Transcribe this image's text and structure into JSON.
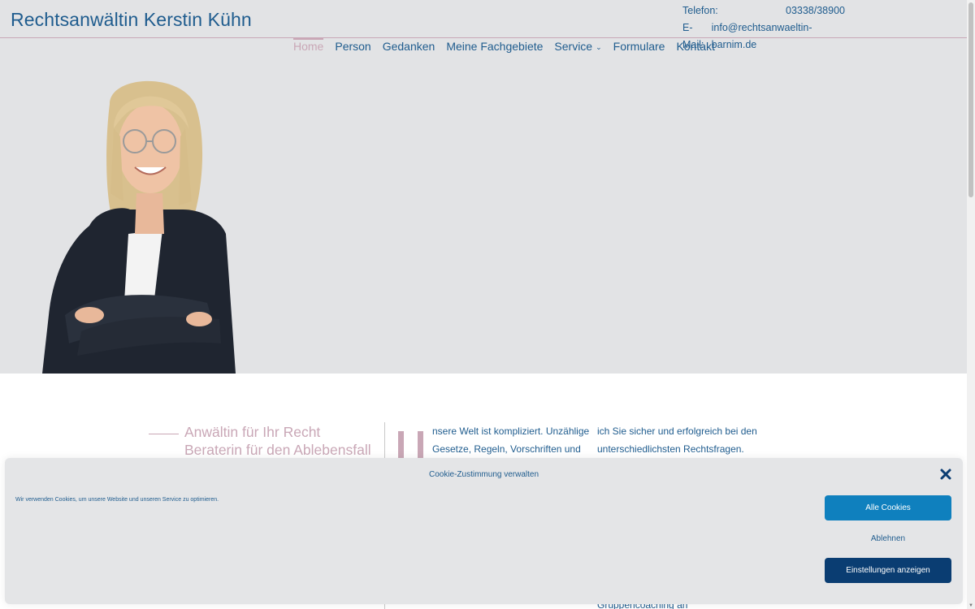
{
  "header": {
    "site_title": "Rechtsanwältin Kerstin Kühn",
    "phone_label": "Telefon:",
    "phone_value": "03338/38900",
    "email_label": "E-Mail:",
    "email_value": "info@rechtsanwaeltin-barnim.de"
  },
  "nav": {
    "items": [
      {
        "label": "Home"
      },
      {
        "label": "Person"
      },
      {
        "label": "Gedanken"
      },
      {
        "label": "Meine Fachgebiete"
      },
      {
        "label": "Service"
      },
      {
        "label": "Formulare"
      },
      {
        "label": "Kontakt"
      }
    ]
  },
  "intro": {
    "tagline_1": "Anwältin für Ihr Recht",
    "tagline_2": "Beraterin für den Ablebensfall",
    "col1_line1": "nsere Welt ist kompliziert. Unzählige",
    "col1_line2": "Gesetze, Regeln, Vorschriften und",
    "col2_line1": "ich Sie sicher und erfolgreich bei den",
    "col2_line2": "unterschiedlichsten Rechtsfragen.",
    "col2_bottom": "Gruppencoaching an"
  },
  "cookie": {
    "title": "Cookie-Zustimmung verwalten",
    "text": "Wir verwenden Cookies, um unsere Website und unseren Service zu optimieren.",
    "accept_label": "Alle Cookies",
    "deny_label": "Ablehnen",
    "settings_label": "Einstellungen anzeigen"
  },
  "colors": {
    "brand_blue": "#1f5c8e",
    "accent_pink": "#c9a7b6",
    "button_blue": "#0f80be",
    "button_dark": "#0a3d72",
    "header_bg": "#e2e3e5"
  }
}
